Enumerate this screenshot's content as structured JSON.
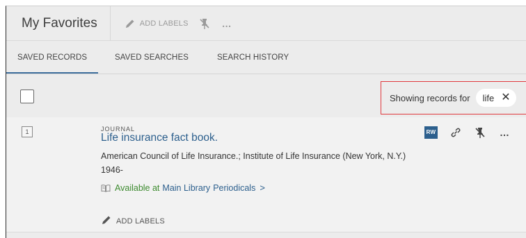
{
  "header": {
    "title": "My Favorites",
    "add_labels": "ADD LABELS",
    "more": "…"
  },
  "tabs": [
    {
      "label": "SAVED RECORDS",
      "active": true
    },
    {
      "label": "SAVED SEARCHES",
      "active": false
    },
    {
      "label": "SEARCH HISTORY",
      "active": false
    }
  ],
  "filter": {
    "label": "Showing records for",
    "chip_text": "life",
    "close": "✕"
  },
  "record": {
    "number": "1",
    "type": "JOURNAL",
    "title": "Life insurance fact book.",
    "author": "American Council of Life Insurance.; Institute of Life Insurance (New York, N.Y.)",
    "date": "1946-",
    "availability": {
      "status": "Available at",
      "location": "Main Library",
      "collection": "Periodicals",
      "chevron": ">"
    },
    "rw_badge": "RW",
    "add_labels": "ADD LABELS",
    "more": "…"
  },
  "colors": {
    "accent": "#2c5f8d",
    "available": "#3c8a2e",
    "highlight_border": "#e0393e",
    "background": "#ececec"
  }
}
